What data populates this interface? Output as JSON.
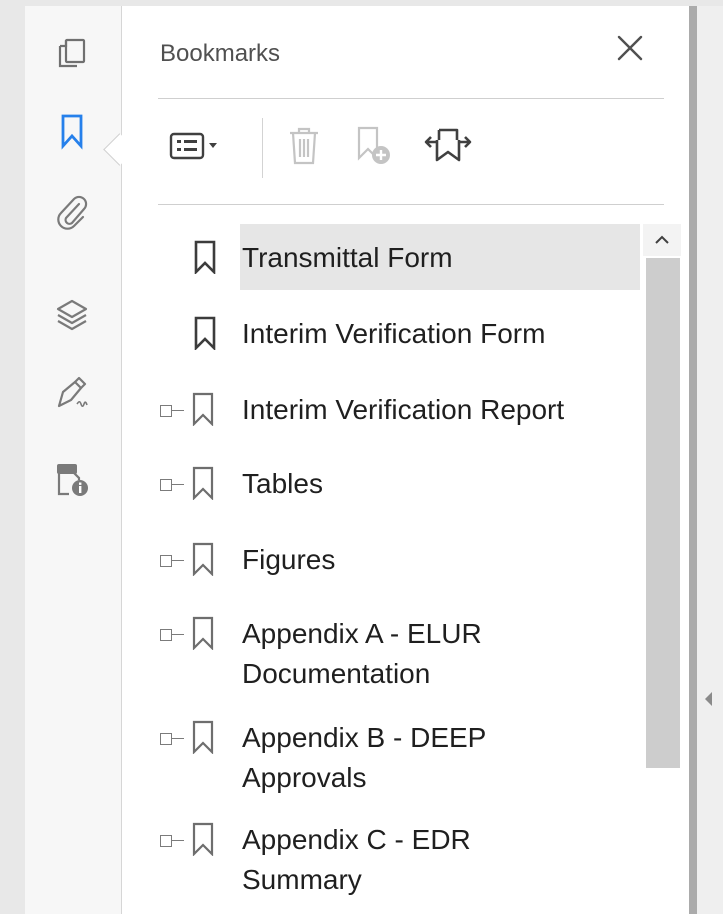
{
  "panel": {
    "title": "Bookmarks",
    "close_label": "×"
  },
  "rail": {
    "items": [
      {
        "name": "pages-icon",
        "active": false
      },
      {
        "name": "bookmark-icon",
        "active": true
      },
      {
        "name": "attachment-icon",
        "active": false
      },
      {
        "name": "layers-icon",
        "active": false
      },
      {
        "name": "signature-icon",
        "active": false
      },
      {
        "name": "security-info-icon",
        "active": false
      }
    ]
  },
  "toolbar": {
    "options": "options-menu-icon",
    "delete": "delete-icon",
    "new_bookmark": "new-bookmark-icon",
    "expand": "expand-bookmark-icon"
  },
  "bookmarks": [
    {
      "label": "Transmittal Form",
      "expandable": false,
      "selected": true
    },
    {
      "label": "Interim Verification Form",
      "expandable": false,
      "selected": false
    },
    {
      "label": "Interim Verification Report",
      "expandable": true,
      "selected": false
    },
    {
      "label": "Tables",
      "expandable": true,
      "selected": false
    },
    {
      "label": "Figures",
      "expandable": true,
      "selected": false
    },
    {
      "label": "Appendix A - ELUR",
      "label2": "Documentation",
      "expandable": true,
      "selected": false
    },
    {
      "label": "Appendix B - DEEP",
      "label2": "Approvals",
      "expandable": true,
      "selected": false
    },
    {
      "label": "Appendix C - EDR",
      "label2": "Summary",
      "expandable": true,
      "selected": false
    }
  ],
  "colors": {
    "accent": "#2680eb",
    "icon_gray": "#6e6e6e"
  }
}
